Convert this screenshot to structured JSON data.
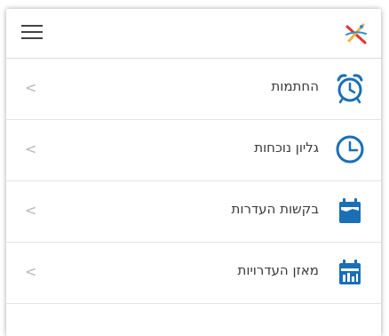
{
  "header": {
    "menu_icon": "hamburger-menu-icon",
    "logo_icon": "brand-logo-icon"
  },
  "menu": {
    "items": [
      {
        "label": "החתמות",
        "icon": "alarm-clock-icon"
      },
      {
        "label": "גליון נוכחות",
        "icon": "clock-icon"
      },
      {
        "label": "בקשות העדרות",
        "icon": "calendar-icon"
      },
      {
        "label": "מאזן העדרויות",
        "icon": "calendar-chart-icon"
      }
    ],
    "chevron_glyph": "<"
  },
  "colors": {
    "icon_blue": "#1a6fb5",
    "text": "#3a3a3a",
    "chevron": "#b7b7b7",
    "logo_red": "#e0342e",
    "logo_yellow": "#f3b33d",
    "logo_blue": "#2a8fd4"
  }
}
